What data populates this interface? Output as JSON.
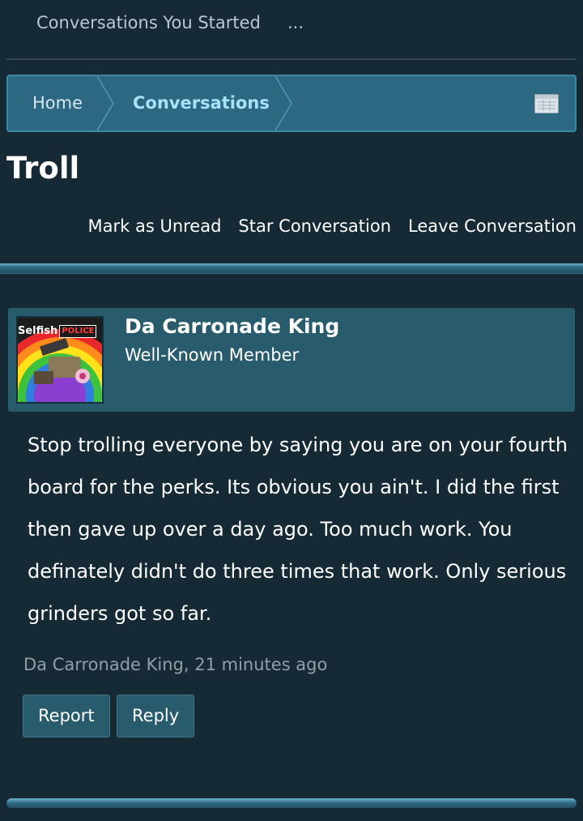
{
  "topnav": {
    "link1": "Conversations You Started",
    "more": "..."
  },
  "breadcrumb": {
    "home": "Home",
    "current": "Conversations"
  },
  "page": {
    "title": "Troll"
  },
  "actions": {
    "mark_unread": "Mark as Unread",
    "star": "Star Conversation",
    "leave": "Leave Conversation"
  },
  "message": {
    "avatar_text_1": "Selfish",
    "avatar_text_2": "POLICE",
    "author": "Da Carronade King",
    "author_title": "Well-Known Member",
    "body": "Stop trolling everyone by saying you are on your fourth board for the perks. Its obvious you ain't. I did the first then gave up over a day ago. Too much work. You definately didn't do three times that work. Only serious grinders got so far.",
    "meta": "Da Carronade King, 21 minutes ago",
    "report_label": "Report",
    "reply_label": "Reply"
  },
  "colors": {
    "background": "#152a35",
    "breadcrumb_bg": "#2c6882",
    "current_crumb": "#a7e3f8",
    "header_bg": "#285b6b"
  }
}
